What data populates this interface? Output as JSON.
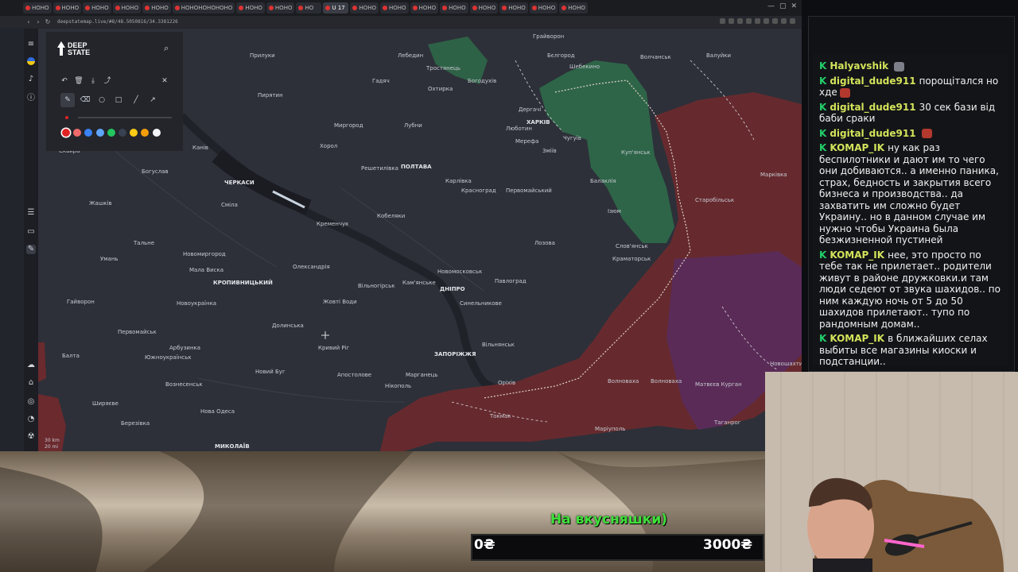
{
  "browser": {
    "url": "deepstatemap.live/#8/48.5050816/34.3381226",
    "tabs": [
      "HOHO",
      "HOHO",
      "HOHO",
      "HOHO",
      "HOHO",
      "HOHOHOHOHOHO",
      "HOHO",
      "HOHO",
      "HO",
      "U 17",
      "HOHO",
      "HOHO",
      "HOHO",
      "HOHO",
      "HOHO",
      "HOHO",
      "HOHO",
      "HOHO"
    ],
    "window_controls": [
      "—",
      "▢",
      "✕"
    ]
  },
  "panel": {
    "logo_line1": "DEEP",
    "logo_line2": "STATE",
    "tools": [
      "↶",
      "🗑",
      "⤓",
      "⤴",
      "✕",
      "✎",
      "⌫",
      "○",
      "□",
      "╱",
      "↗"
    ],
    "swatches": [
      "#e02424",
      "#ef6a6a",
      "#3b82f6",
      "#60a5fa",
      "#22c55e",
      "#374151",
      "#facc15",
      "#f59e0b",
      "#f3f4f6"
    ]
  },
  "map": {
    "scale_top": "30 km",
    "scale_bottom": "20 mi",
    "cities": [
      {
        "name": "Прилуки",
        "big": false
      },
      {
        "name": "Лебедин",
        "big": false
      },
      {
        "name": "Тростянець",
        "big": false
      },
      {
        "name": "Грайворон",
        "big": false
      },
      {
        "name": "Бєлгород",
        "big": false
      },
      {
        "name": "Шебекино",
        "big": false
      },
      {
        "name": "Волчанськ",
        "big": false
      },
      {
        "name": "Валуйки",
        "big": false
      },
      {
        "name": "Пирятин",
        "big": false
      },
      {
        "name": "Гадяч",
        "big": false
      },
      {
        "name": "Охтирка",
        "big": false
      },
      {
        "name": "Богодухів",
        "big": false
      },
      {
        "name": "Дергачі",
        "big": false
      },
      {
        "name": "ХАРКІВ",
        "big": true
      },
      {
        "name": "Миргород",
        "big": false
      },
      {
        "name": "Лубни",
        "big": false
      },
      {
        "name": "Люботин",
        "big": false
      },
      {
        "name": "Мерефа",
        "big": false
      },
      {
        "name": "Чугуїв",
        "big": false
      },
      {
        "name": "Куп'янськ",
        "big": false
      },
      {
        "name": "Канів",
        "big": false
      },
      {
        "name": "Хорол",
        "big": false
      },
      {
        "name": "Решетилівка",
        "big": false
      },
      {
        "name": "ПОЛТАВА",
        "big": true
      },
      {
        "name": "Зміїв",
        "big": false
      },
      {
        "name": "Балаклія",
        "big": false
      },
      {
        "name": "Сквира",
        "big": false
      },
      {
        "name": "Богуслав",
        "big": false
      },
      {
        "name": "ЧЕРКАСИ",
        "big": true
      },
      {
        "name": "Карлівка",
        "big": false
      },
      {
        "name": "Красноград",
        "big": false
      },
      {
        "name": "Первомайський",
        "big": false
      },
      {
        "name": "Ізюм",
        "big": false
      },
      {
        "name": "Жашків",
        "big": false
      },
      {
        "name": "Сміла",
        "big": false
      },
      {
        "name": "Кобеляки",
        "big": false
      },
      {
        "name": "Лозова",
        "big": false
      },
      {
        "name": "Кременчук",
        "big": false
      },
      {
        "name": "Слов'янськ",
        "big": false
      },
      {
        "name": "Тальне",
        "big": false
      },
      {
        "name": "Новомиргород",
        "big": false
      },
      {
        "name": "Умань",
        "big": false
      },
      {
        "name": "Олександрія",
        "big": false
      },
      {
        "name": "Новомосковськ",
        "big": false
      },
      {
        "name": "Краматорськ",
        "big": false
      },
      {
        "name": "Мала Виска",
        "big": false
      },
      {
        "name": "КРОПИВНИЦЬКИЙ",
        "big": true
      },
      {
        "name": "Вільногірськ",
        "big": false
      },
      {
        "name": "Кам'янське",
        "big": false
      },
      {
        "name": "ДНІПРО",
        "big": true
      },
      {
        "name": "Павлоград",
        "big": false
      },
      {
        "name": "Гайворон",
        "big": false
      },
      {
        "name": "Новоукраїнка",
        "big": false
      },
      {
        "name": "Жовті Води",
        "big": false
      },
      {
        "name": "Синельникове",
        "big": false
      },
      {
        "name": "Первомайськ",
        "big": false
      },
      {
        "name": "Долинська",
        "big": false
      },
      {
        "name": "Кривий Ріг",
        "big": false
      },
      {
        "name": "Балта",
        "big": false
      },
      {
        "name": "Арбузинка",
        "big": false
      },
      {
        "name": "Южноукраїнськ",
        "big": false
      },
      {
        "name": "ЗАПОРІЖЖЯ",
        "big": true
      },
      {
        "name": "Вільнянськ",
        "big": false
      },
      {
        "name": "Новий Буг",
        "big": false
      },
      {
        "name": "Апостолове",
        "big": false
      },
      {
        "name": "Марганець",
        "big": false
      },
      {
        "name": "Вознесенськ",
        "big": false
      },
      {
        "name": "Нікополь",
        "big": false
      },
      {
        "name": "Оріхів",
        "big": false
      },
      {
        "name": "Волноваха",
        "big": false
      },
      {
        "name": "Ширяєве",
        "big": false
      },
      {
        "name": "Нова Одеса",
        "big": false
      },
      {
        "name": "Токмак",
        "big": false
      },
      {
        "name": "Березівка",
        "big": false
      },
      {
        "name": "МИКОЛАЇВ",
        "big": true
      },
      {
        "name": "Маріуполь",
        "big": false
      },
      {
        "name": "Матвєєв Курган",
        "big": false
      },
      {
        "name": "Таганрог",
        "big": false
      },
      {
        "name": "Старобільськ",
        "big": false
      },
      {
        "name": "Марківка",
        "big": false
      },
      {
        "name": "Новошахтинськ",
        "big": false
      },
      {
        "name": "Волноваха",
        "big": false
      }
    ]
  },
  "chat": {
    "messages": [
      {
        "user": "Halyavshik",
        "text": "",
        "emote": "grey"
      },
      {
        "user": "digital_dude911",
        "text": "порощітался но хде",
        "emote": "red"
      },
      {
        "user": "digital_dude911",
        "text": "30 сек бази від баби сраки",
        "emote": ""
      },
      {
        "user": "digital_dude911",
        "text": "",
        "emote": "red"
      },
      {
        "user": "KOMAP_IK",
        "text": "ну как раз беспилотники и дают им то чего они добиваются.. а именно паника, страх, бедность и закрытия всего бизнеса и производства.. да захватить им сложно будет Украину.. но в данном случае им нужно чтобы Украина была безжизненной пустиней",
        "emote": ""
      },
      {
        "user": "KOMAP_IK",
        "text": "нее, это просто по тебе так не прилетает.. родители живут в районе дружковки.и там люди седеют от звука шахидов.. по ним каждую ночь от 5 до 50 шахидов прилетают.. тупо по рандомным домам..",
        "emote": ""
      },
      {
        "user": "KOMAP_IK",
        "text": "в ближайших селах выбиты все магазины киоски и подстанции..",
        "emote": ""
      }
    ]
  },
  "donation": {
    "label": "На вкусняшки)",
    "current": "0₴",
    "goal": "3000₴",
    "progress": 0
  },
  "colors": {
    "occupied": "#6b2a2e",
    "liberated": "#2f6b4a",
    "occupied_2014": "#5a2b5a",
    "chat_username": "#d3e35a",
    "donate_green": "#3fe03a"
  }
}
